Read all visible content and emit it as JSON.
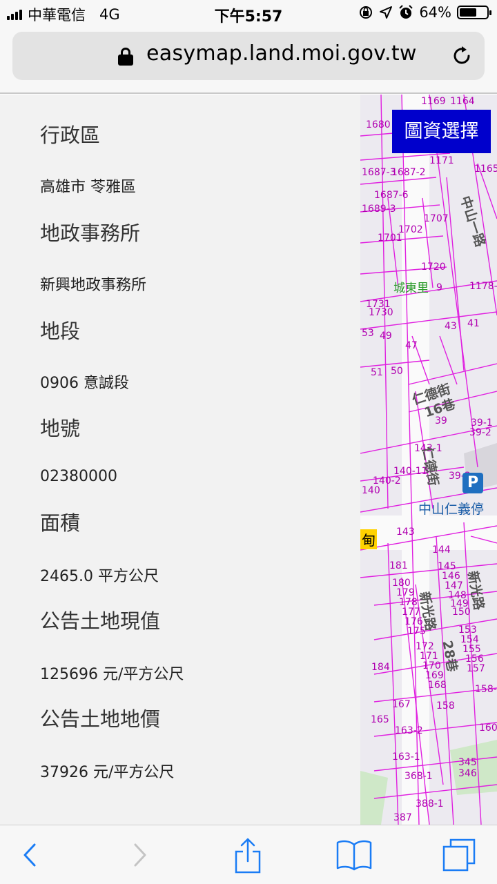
{
  "status_bar": {
    "carrier": "中華電信",
    "network": "4G",
    "time": "下午5:57",
    "battery_percent_text": "64%",
    "battery_level": 0.64
  },
  "address_bar": {
    "url": "easymap.land.moi.gov.tw"
  },
  "map": {
    "select_button": "圖資選擇",
    "place_label": "城東里",
    "parking_label": "中山仁義停",
    "parking_icon": "P",
    "yellow_label": "甸",
    "streets": [
      "仁德街",
      "16巷",
      "仁德街",
      "新光路",
      "新光路",
      "28巷",
      "中山一路"
    ],
    "parcels": [
      "1169",
      "1164",
      "1680",
      "1171",
      "1165",
      "1687-3",
      "1687-2",
      "1687-6",
      "1689-3",
      "1707",
      "1702",
      "1701",
      "1720",
      "1178-",
      "1731",
      "1730",
      "43",
      "41",
      "53",
      "49",
      "47",
      "51",
      "50",
      "39",
      "39-1",
      "39-2",
      "143-1",
      "140-11",
      "39-3",
      "140-2",
      "140",
      "143",
      "144",
      "181",
      "145",
      "146",
      "180",
      "147",
      "179",
      "148",
      "149",
      "178",
      "150",
      "177",
      "176",
      "153",
      "175",
      "154",
      "172",
      "155",
      "171",
      "156",
      "170",
      "157",
      "169",
      "184",
      "168",
      "158-",
      "167",
      "158",
      "165",
      "163-2",
      "160",
      "163-1",
      "345",
      "346",
      "368-1",
      "388-1",
      "387",
      "9"
    ]
  },
  "panel": {
    "items": [
      {
        "heading": "行政區",
        "value": "高雄市 苓雅區"
      },
      {
        "heading": "地政事務所",
        "value": "新興地政事務所"
      },
      {
        "heading": "地段",
        "value": "0906 意誠段"
      },
      {
        "heading": "地號",
        "value": "02380000"
      },
      {
        "heading": "面積",
        "value": "2465.0 平方公尺"
      },
      {
        "heading": "公告土地現值",
        "value": "125696 元/平方公尺"
      },
      {
        "heading": "公告土地地價",
        "value": "37926 元/平方公尺"
      }
    ]
  },
  "toolbar": {
    "icons": [
      "back-icon",
      "forward-icon",
      "share-icon",
      "bookmarks-icon",
      "tabs-icon"
    ],
    "accent": "#1a7cf5"
  }
}
